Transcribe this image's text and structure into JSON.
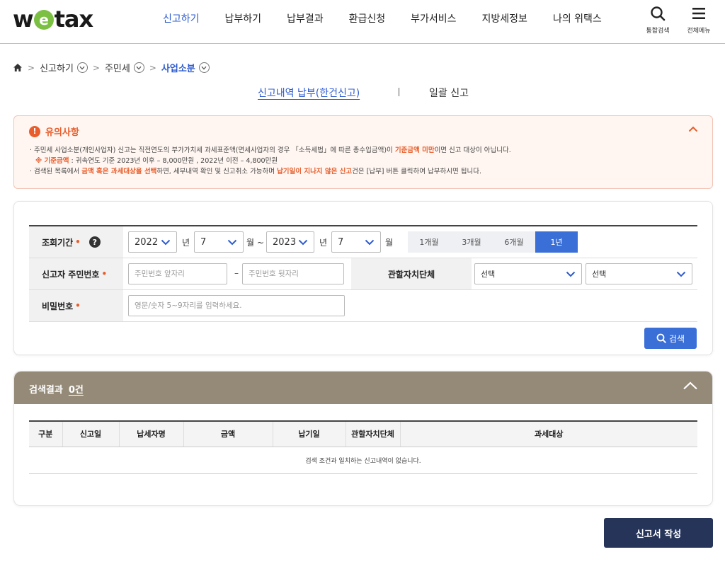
{
  "header": {
    "logo_pre": "w",
    "logo_e": "e",
    "logo_post": "tax",
    "nav": [
      "신고하기",
      "납부하기",
      "납부결과",
      "환급신청",
      "부가서비스",
      "지방세정보",
      "나의 위택스"
    ],
    "search_label": "통합검색",
    "menu_label": "전체메뉴",
    "accent": "#2d5bcf"
  },
  "breadcrumb": {
    "items": [
      "신고하기",
      "주민세",
      "사업소분"
    ]
  },
  "tabs": {
    "main": "신고내역 납부(한건신고)",
    "second": "일괄 신고"
  },
  "notice": {
    "title": "유의사항",
    "line1_a": "· 주민세 사업소분(개인사업자) 신고는 직전연도의 부가가치세 과세표준액(면세사업자의 경우 「소득세법」에 따른 총수입금액)이 ",
    "line1_hl": "기준금액 미만",
    "line1_b": "이면 신고 대상이 아닙니다.",
    "line2_hl": "※ 기준금액",
    "line2_b": " : 귀속연도 기준 2023년 이후 – 8,000만원 , 2022년 이전 – 4,800만원",
    "line3_a": "· 검색된 목록에서 ",
    "line3_hl1": "금액 혹은 과세대상을 선택",
    "line3_b": "하면, 세부내역 확인 및 신고취소 가능하며 ",
    "line3_hl2": "납기일이 지나지 않은 신고",
    "line3_c": "건은 [납부] 버튼 클릭하여 납부하시면 됩니다.",
    "color": "#e85d2b"
  },
  "search": {
    "period_label": "조회기간",
    "required_mark": "•",
    "help_glyph": "?",
    "start_year": "2022",
    "start_month": "7",
    "end_year": "2023",
    "end_month": "7",
    "year_unit": "년",
    "month_unit_range": "월 ~",
    "month_unit": "월",
    "period_buttons": [
      "1개월",
      "3개월",
      "6개월",
      "1년"
    ],
    "period_active": "1년",
    "rrn_label": "신고자 주민번호",
    "rrn_front_placeholder": "주민번호 앞자리",
    "rrn_back_placeholder": "주민번호 뒷자리",
    "rrn_dash": "–",
    "region_label": "관할자치단체",
    "region_select1": "선택",
    "region_select2": "선택",
    "password_label": "비밀번호",
    "password_placeholder": "영문/숫자 5~9자리를 입력하세요.",
    "search_button": "검색"
  },
  "results": {
    "title": "검색결과",
    "count": "0건",
    "columns": [
      "구분",
      "신고일",
      "납세자명",
      "금액",
      "납기일",
      "관할자치단체",
      "과세대상"
    ],
    "empty_message": "검색 조건과 일치하는 신고내역이 없습니다.",
    "header_color": "#958a78"
  },
  "actions": {
    "write_button": "신고서 작성"
  }
}
